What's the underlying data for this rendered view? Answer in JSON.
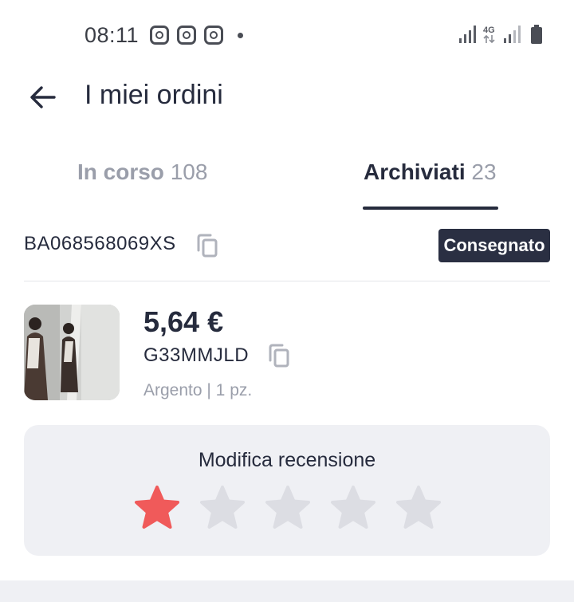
{
  "status_bar": {
    "time": "08:11",
    "notification_icons": [
      "instagram-icon",
      "instagram-icon",
      "instagram-icon"
    ],
    "network_label": "4G"
  },
  "header": {
    "back_icon": "arrow-left-icon",
    "title": "I miei ordini"
  },
  "tabs": [
    {
      "label": "In corso",
      "count": "108",
      "active": false
    },
    {
      "label": "Archiviati",
      "count": "23",
      "active": true
    }
  ],
  "order": {
    "code": "BA068568069XS",
    "status": "Consegnato",
    "product": {
      "price": "5,64 €",
      "sku": "G33MMJLD",
      "variant": "Argento | 1 pz."
    }
  },
  "review": {
    "title": "Modifica recensione",
    "rating": 1,
    "max_rating": 5
  },
  "colors": {
    "primary_dark": "#262b3d",
    "muted_text": "#9a9eaa",
    "star_active": "#f05a5a",
    "star_inactive": "#dcdde3",
    "card_background": "#eff0f4"
  }
}
